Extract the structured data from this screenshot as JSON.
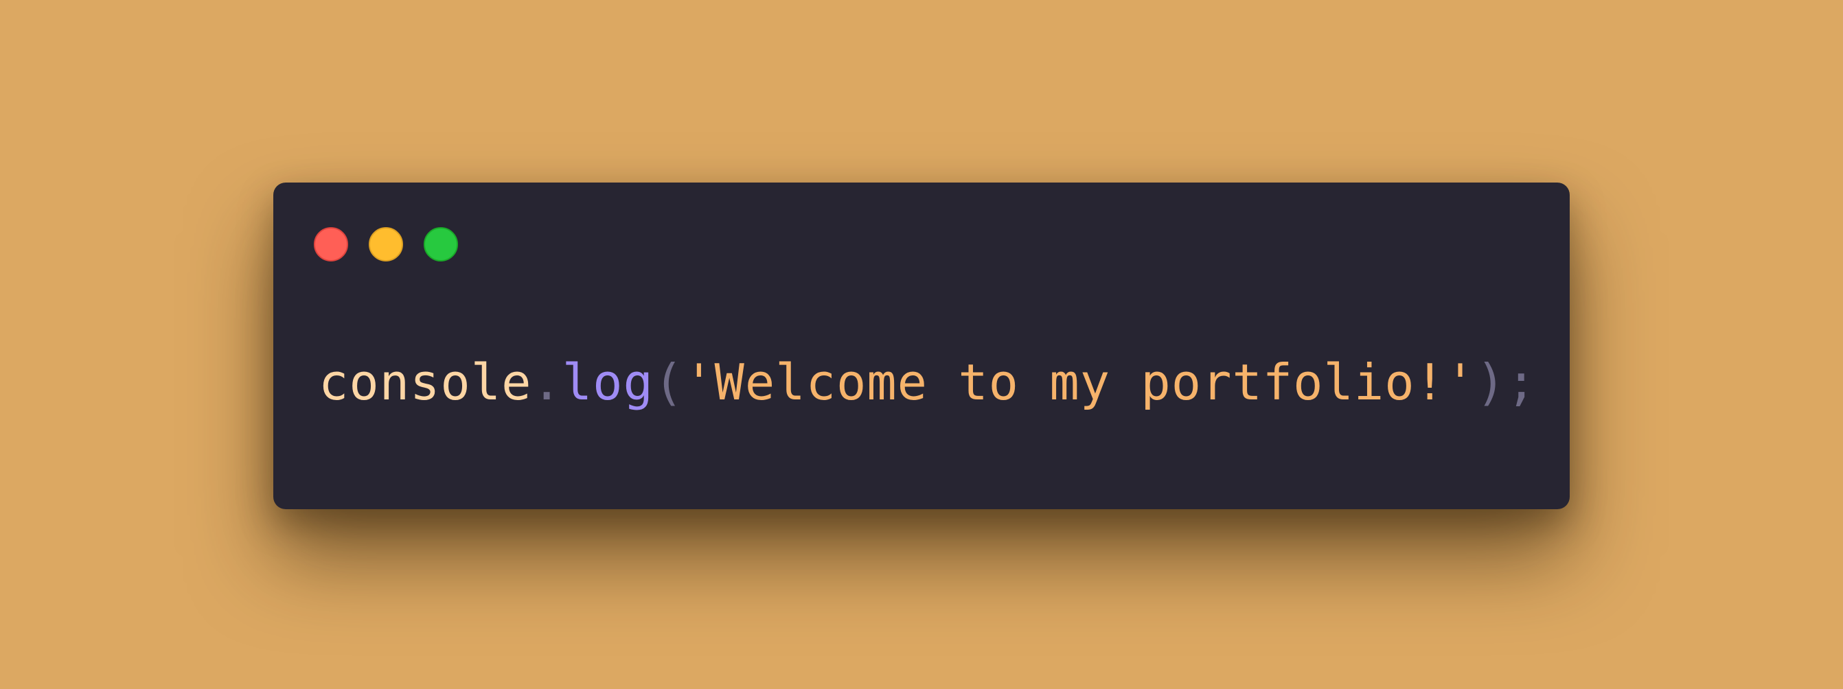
{
  "window": {
    "controls": [
      {
        "name": "close",
        "color": "#ff5f56"
      },
      {
        "name": "minimize",
        "color": "#ffbd2e"
      },
      {
        "name": "maximize",
        "color": "#27c93f"
      }
    ]
  },
  "code": {
    "object": "console",
    "dot": ".",
    "method": "log",
    "open_paren": "(",
    "string": "'Welcome to my portfolio!'",
    "close_paren": ")",
    "semicolon": ";"
  },
  "colors": {
    "background": "#dca862",
    "editor_background": "#272532",
    "identifier": "#fdd6a5",
    "punctuation": "#6e6a86",
    "function": "#9f8cf5",
    "string": "#f6b36b"
  }
}
